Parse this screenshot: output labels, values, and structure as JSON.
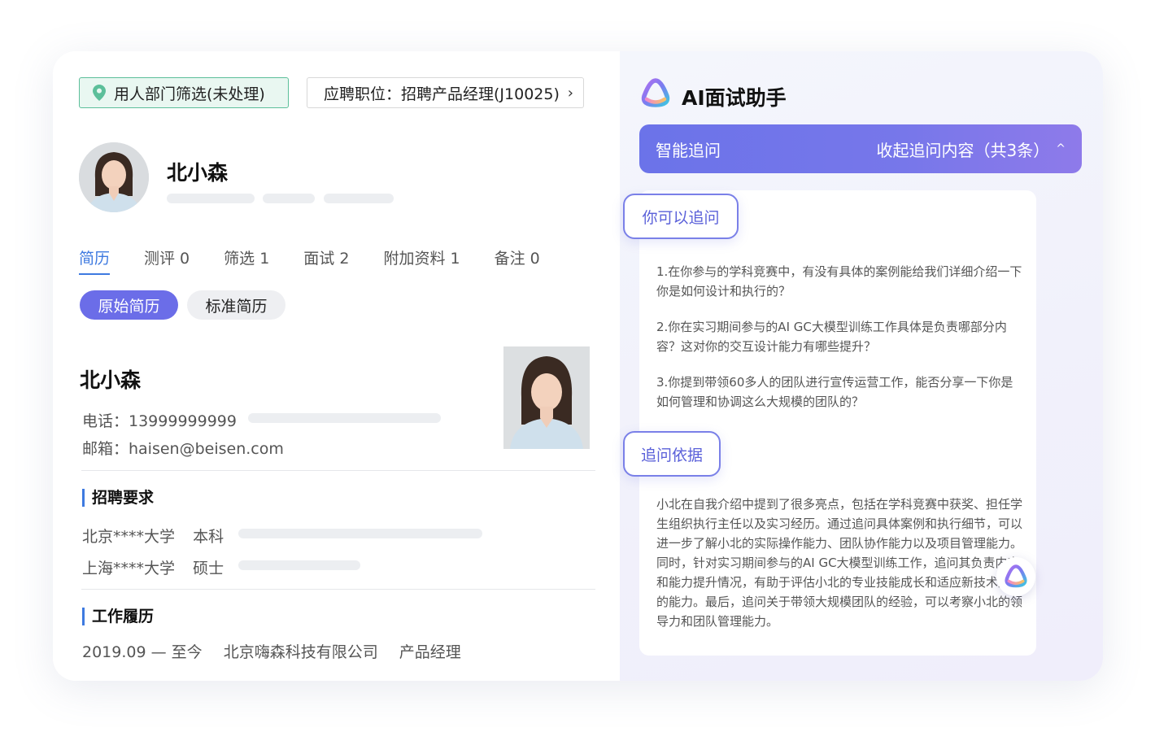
{
  "candidate": {
    "status_tag": "用人部门筛选(未处理)",
    "position": "应聘职位：招聘产品经理(J10025)",
    "name": "北小森"
  },
  "tabs": [
    {
      "label": "简历"
    },
    {
      "label": "测评 0"
    },
    {
      "label": "筛选 1"
    },
    {
      "label": "面试 2"
    },
    {
      "label": "附加资料 1"
    },
    {
      "label": "备注 0"
    }
  ],
  "resume_toggle": {
    "original": "原始简历",
    "standard": "标准简历"
  },
  "resume": {
    "name": "北小森",
    "phone": "电话：13999999999",
    "email": "邮箱：haisen@beisen.com",
    "recruit_title": "招聘要求",
    "education": [
      {
        "school": "北京****大学",
        "degree": "本科"
      },
      {
        "school": "上海****大学",
        "degree": "硕士"
      }
    ],
    "work_title": "工作履历",
    "work": {
      "period": "2019.09 — 至今",
      "company": "北京嗨森科技有限公司",
      "role": "产品经理"
    }
  },
  "ai_panel": {
    "title": "AI面试助手",
    "bar_left": "智能追问",
    "bar_right": "收起追问内容（共3条）",
    "badge_followup": "你可以追问",
    "questions": [
      "1.在你参与的学科竞赛中，有没有具体的案例能给我们详细介绍一下你是如何设计和执行的？",
      "2.你在实习期间参与的AI GC大模型训练工作具体是负责哪部分内容？这对你的交互设计能力有哪些提升？",
      "3.你提到带领60多人的团队进行宣传运营工作，能否分享一下你是如何管理和协调这么大规模的团队的？"
    ],
    "badge_basis": "追问依据",
    "basis": "小北在自我介绍中提到了很多亮点，包括在学科竞赛中获奖、担任学生组织执行主任以及实习经历。通过追问具体案例和执行细节，可以进一步了解小北的实际操作能力、团队协作能力以及项目管理能力。同时，针对实习期间参与的AI GC大模型训练工作，追问其负责内容和能力提升情况，有助于评估小北的专业技能成长和适应新技术趋势的能力。最后，追问关于带领大规模团队的经验，可以考察小北的领导力和团队管理能力。"
  },
  "colors": {
    "accent_blue": "#3e7ae0",
    "accent_purple": "#6b6de8",
    "status_green": "#5cbf9a"
  },
  "icons": {
    "status": "location-pin-icon",
    "position": "chevron-right-icon",
    "ai": "ai-logo-icon",
    "collapse": "chevron-up-icon"
  }
}
